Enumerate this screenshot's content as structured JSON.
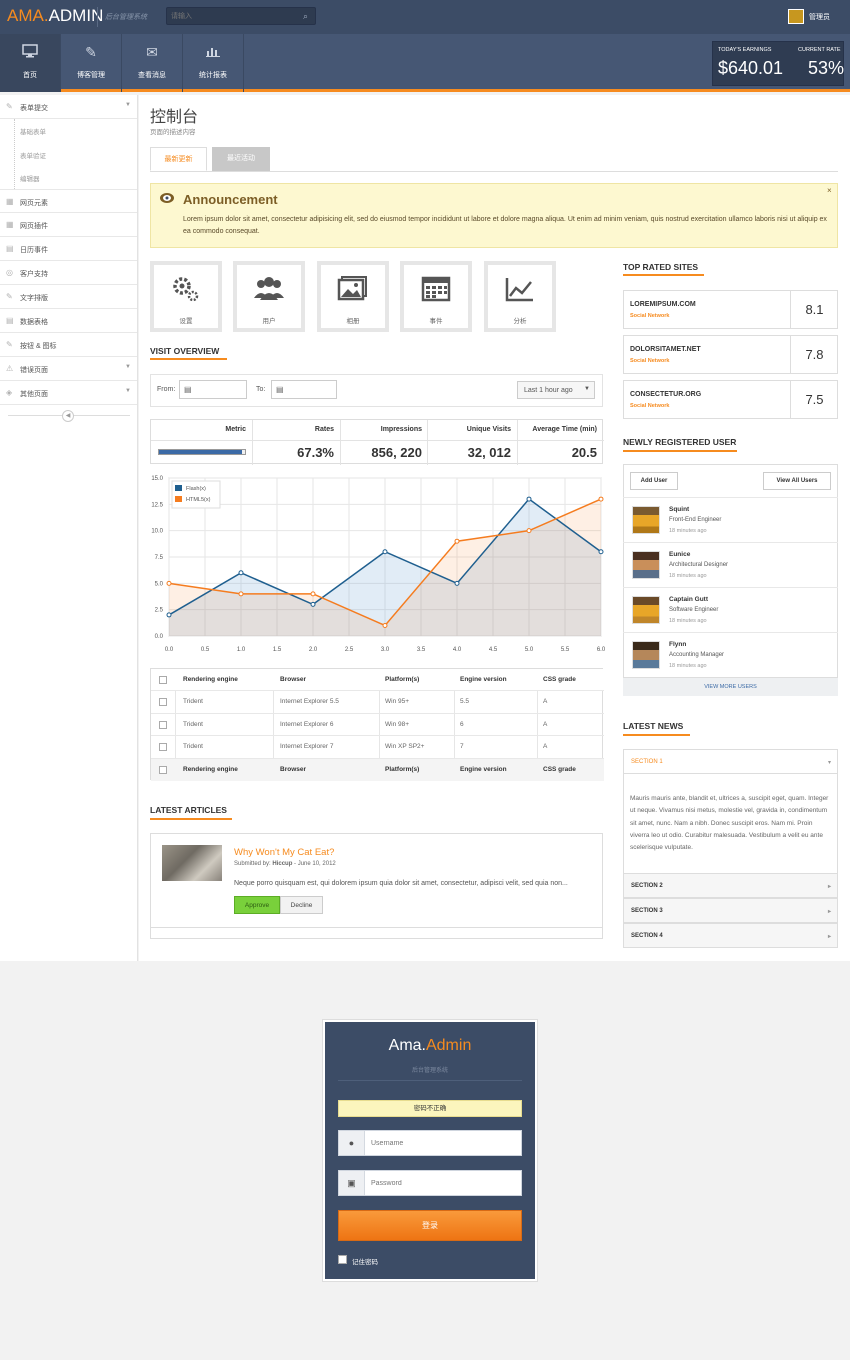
{
  "brand": {
    "ama": "AMA.",
    "admin": "ADMIN",
    "subtitle": "后台管理系统"
  },
  "search": {
    "placeholder": "请输入"
  },
  "user": {
    "name": "管理员"
  },
  "nav": [
    {
      "label": "首页",
      "icon": "monitor-icon"
    },
    {
      "label": "博客管理",
      "icon": "pencil-icon"
    },
    {
      "label": "查看消息",
      "icon": "envelope-icon"
    },
    {
      "label": "统计报表",
      "icon": "bar-chart-icon"
    }
  ],
  "earnings": {
    "label": "TODAY'S EARNINGS",
    "value": "$640.01"
  },
  "rate": {
    "label": "CURRENT RATE",
    "value": "53%"
  },
  "sidebar": {
    "items": [
      {
        "label": "表单提交",
        "icon": "pencil-icon"
      },
      {
        "label": "网页元素",
        "icon": "grid-icon"
      },
      {
        "label": "网页插件",
        "icon": "grid-icon"
      },
      {
        "label": "日历事件",
        "icon": "calendar-icon"
      },
      {
        "label": "客户支持",
        "icon": "lifebuoy-icon"
      },
      {
        "label": "文字排版",
        "icon": "pencil-icon"
      },
      {
        "label": "数据表格",
        "icon": "table-icon"
      },
      {
        "label": "按钮 & 图标",
        "icon": "pencil-icon"
      },
      {
        "label": "错误页面",
        "icon": "warning-icon"
      },
      {
        "label": "其他页面",
        "icon": "shield-icon"
      }
    ],
    "sub_items": [
      "基础表单",
      "表单验证",
      "编辑器"
    ]
  },
  "page": {
    "title": "控制台",
    "desc": "页面的描述内容"
  },
  "tabs": [
    "最新更新",
    "最近活动"
  ],
  "announcement": {
    "title": "Announcement",
    "text": "Lorem ipsum dolor sit amet, consectetur adipisicing elit, sed do eiusmod tempor incididunt ut labore et dolore magna aliqua. Ut enim ad minim veniam, quis nostrud exercitation ullamco laboris nisi ut aliquip ex ea commodo consequat.",
    "close": "×"
  },
  "tiles": [
    {
      "label": "设置",
      "icon": "gears-icon"
    },
    {
      "label": "用户",
      "icon": "users-icon"
    },
    {
      "label": "相册",
      "icon": "pictures-icon"
    },
    {
      "label": "事件",
      "icon": "calendar-icon"
    },
    {
      "label": "分析",
      "icon": "line-chart-icon"
    }
  ],
  "visit_overview": {
    "title": "VISIT OVERVIEW",
    "from": "From:",
    "to": "To:",
    "range": "Last 1 hour ago"
  },
  "metrics": {
    "headers": [
      "Metric",
      "Rates",
      "Impressions",
      "Unique Visits",
      "Average Time (min)"
    ],
    "values": [
      "67.3%",
      "856, 220",
      "32, 012",
      "20.5"
    ],
    "progress": 0.96
  },
  "chart_data": {
    "type": "line",
    "x": [
      0,
      1,
      2,
      3,
      4,
      5,
      6
    ],
    "series": [
      {
        "name": "Flash(x)",
        "color": "#1f5f8f",
        "values": [
          2,
          6,
          3,
          8,
          5,
          13,
          8
        ]
      },
      {
        "name": "HTML5(x)",
        "color": "#f57c1f",
        "values": [
          5,
          4,
          4,
          1,
          9,
          10,
          13
        ]
      }
    ],
    "xlim": [
      0,
      6
    ],
    "ylim": [
      0,
      15
    ],
    "xticks": [
      "0.0",
      "0.5",
      "1.0",
      "1.5",
      "2.0",
      "2.5",
      "3.0",
      "3.5",
      "4.0",
      "4.5",
      "5.0",
      "5.5",
      "6.0"
    ],
    "yticks": [
      "0.0",
      "2.5",
      "5.0",
      "7.5",
      "10.0",
      "12.5",
      "15.0"
    ],
    "grid": true,
    "legend": "top-left"
  },
  "data_table": {
    "headers": [
      "Rendering engine",
      "Browser",
      "Platform(s)",
      "Engine version",
      "CSS grade"
    ],
    "rows": [
      [
        "Trident",
        "Internet Explorer 5.5",
        "Win 95+",
        "5.5",
        "A"
      ],
      [
        "Trident",
        "Internet Explorer 6",
        "Win 98+",
        "6",
        "A"
      ],
      [
        "Trident",
        "Internet Explorer 7",
        "Win XP SP2+",
        "7",
        "A"
      ]
    ]
  },
  "articles": {
    "title": "LATEST ARTICLES",
    "item": {
      "title": "Why Won't My Cat Eat?",
      "by_prefix": "Submitted by: ",
      "author": "Hiccup",
      "date": " - June 10, 2012",
      "text": "Neque porro quisquam est, qui dolorem ipsum quia dolor sit amet, consectetur, adipisci velit, sed quia non...",
      "approve": "Approve",
      "decline": "Decline"
    }
  },
  "top_sites": {
    "title": "TOP RATED SITES",
    "items": [
      {
        "name": "LOREMIPSUM.COM",
        "cat": "Social Network",
        "score": "8.1"
      },
      {
        "name": "DOLORSITAMET.NET",
        "cat": "Social Network",
        "score": "7.8"
      },
      {
        "name": "CONSECTETUR.ORG",
        "cat": "Social Network",
        "score": "7.5"
      }
    ]
  },
  "new_users": {
    "title": "NEWLY REGISTERED USER",
    "add": "Add User",
    "view_all": "View All Users",
    "view_more": "VIEW MORE USERS",
    "items": [
      {
        "name": "Squint",
        "role": "Front-End Engineer",
        "time": "18 minutes ago",
        "color": "#e8a628"
      },
      {
        "name": "Eunice",
        "role": "Architectural Designer",
        "time": "18 minutes ago",
        "color": "#c98f5a"
      },
      {
        "name": "Captain Gutt",
        "role": "Software Engineer",
        "time": "18 minutes ago",
        "color": "#e8a628"
      },
      {
        "name": "Flynn",
        "role": "Accounting Manager",
        "time": "18 minutes ago",
        "color": "#b5875a"
      }
    ]
  },
  "news": {
    "title": "LATEST NEWS",
    "sections": [
      "SECTION 1",
      "SECTION 2",
      "SECTION 3",
      "SECTION 4"
    ],
    "body": "Mauris mauris ante, blandit et, ultrices a, suscipit eget, quam. Integer ut neque. Vivamus nisi metus, molestie vel, gravida in, condimentum sit amet, nunc. Nam a nibh. Donec suscipit eros. Nam mi. Proin viverra leo ut odio. Curabitur malesuada. Vestibulum a velit eu ante scelerisque vulputate."
  },
  "login": {
    "ama": "Ama.",
    "admin": "Admin",
    "subtitle": "后台管理系统",
    "error": "密码不正确",
    "username_ph": "Username",
    "password_ph": "Password",
    "submit": "登录",
    "remember": "记住密码"
  }
}
